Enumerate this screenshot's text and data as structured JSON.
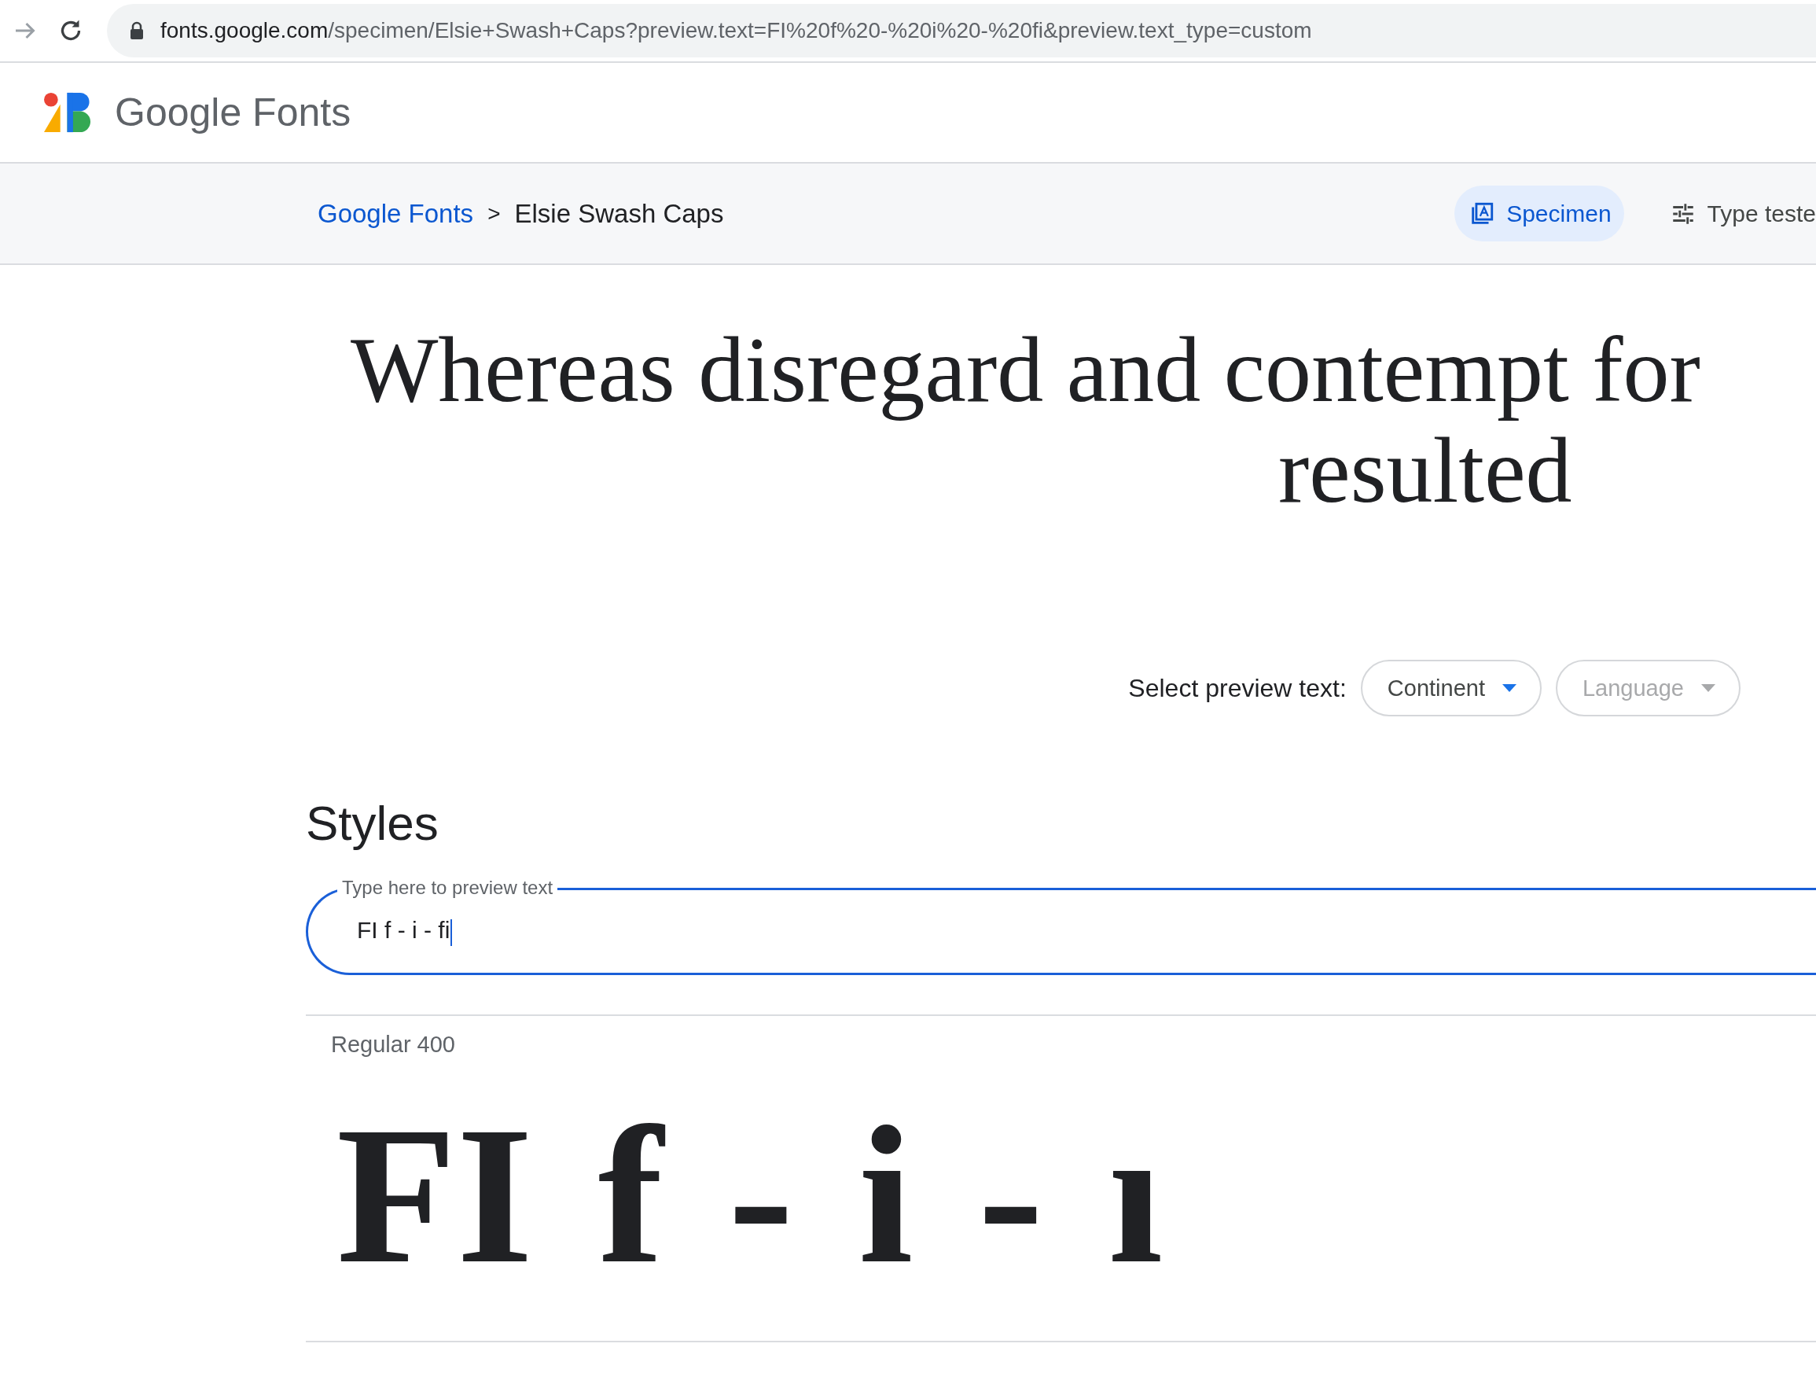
{
  "browser": {
    "url_host": "fonts.google.com",
    "url_path": "/specimen/Elsie+Swash+Caps?preview.text=FI%20f%20-%20i%20-%20fi&preview.text_type=custom"
  },
  "header": {
    "brand": "Google Fonts"
  },
  "breadcrumb": {
    "items": [
      "Google Fonts",
      ">",
      "Elsie Swash Caps"
    ]
  },
  "tabs": [
    {
      "label": "Specimen",
      "kind": "specimen",
      "selected": true
    },
    {
      "label": "Type teste",
      "kind": "tester",
      "selected": false
    }
  ],
  "headline": {
    "lines": [
      "Whereas disregard and contempt for",
      "resulted"
    ]
  },
  "preview_select": {
    "label": "Select preview text:",
    "dropdowns": [
      {
        "label": "Continent",
        "disabled": false
      },
      {
        "label": "Language",
        "disabled": true
      }
    ]
  },
  "styles": {
    "title": "Styles",
    "field": {
      "placeholder": "Type here to preview text",
      "value": "FI f - i - fi"
    },
    "items": [
      {
        "name": "Regular 400",
        "sample": "FI f - i - ı"
      }
    ]
  }
}
